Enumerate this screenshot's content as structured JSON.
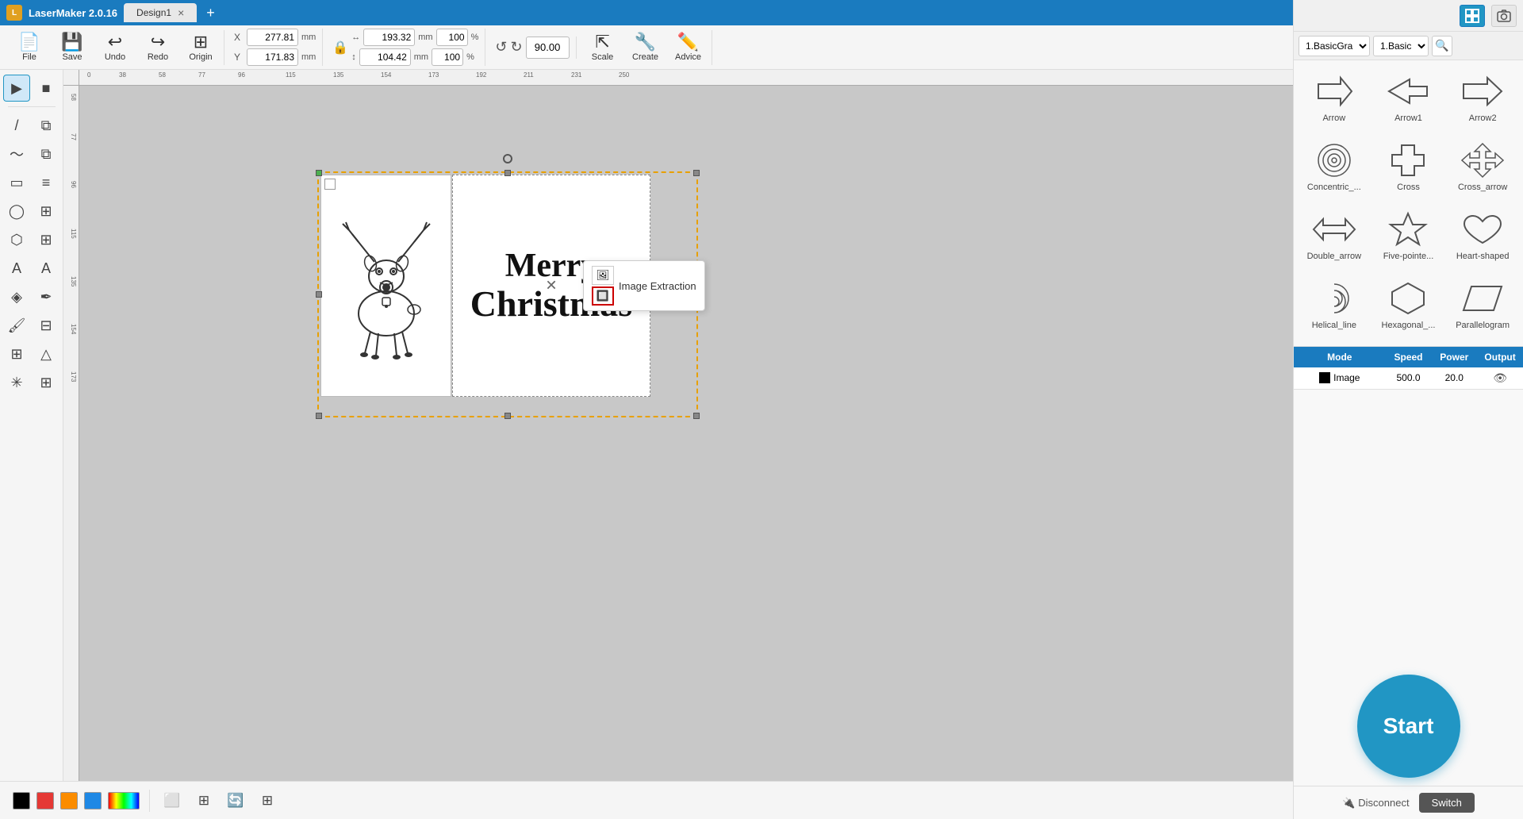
{
  "app": {
    "name": "LaserMaker 2.0.16",
    "version": "2.0.16",
    "tab": "Design1"
  },
  "titlebar": {
    "app_label": "LaserMaker 2.0.16",
    "tab_label": "Design1",
    "tab_close": "×",
    "tab_add": "+",
    "minimize": "—",
    "maximize": "❐",
    "close": "×"
  },
  "toolbar": {
    "file_label": "File",
    "save_label": "Save",
    "undo_label": "Undo",
    "redo_label": "Redo",
    "origin_label": "Origin",
    "scale_label": "Scale",
    "create_label": "Create",
    "advice_label": "Advice",
    "x_label": "X",
    "y_label": "Y",
    "x_value": "277.81",
    "y_value": "171.83",
    "mm_label": "mm",
    "w_value": "193.32",
    "h_value": "104.42",
    "w_pct": "100",
    "h_pct": "100",
    "pct_label": "%",
    "rotate_value": "90.00"
  },
  "shapes_panel": {
    "filter1": "1.BasicGra",
    "filter2": "1.Basic",
    "shapes": [
      {
        "id": "arrow",
        "label": "Arrow"
      },
      {
        "id": "arrow1",
        "label": "Arrow1"
      },
      {
        "id": "arrow2",
        "label": "Arrow2"
      },
      {
        "id": "concentric",
        "label": "Concentric_..."
      },
      {
        "id": "cross",
        "label": "Cross"
      },
      {
        "id": "cross_arrow",
        "label": "Cross_arrow"
      },
      {
        "id": "double_arrow",
        "label": "Double_arrow"
      },
      {
        "id": "five_pointer",
        "label": "Five-pointe..."
      },
      {
        "id": "heart_shaped",
        "label": "Heart-shaped"
      },
      {
        "id": "helical_line",
        "label": "Helical_line"
      },
      {
        "id": "hexagonal",
        "label": "Hexagonal_..."
      },
      {
        "id": "parallelogram",
        "label": "Parallelogram"
      }
    ]
  },
  "laser_settings": {
    "headers": [
      "Mode",
      "Speed",
      "Power",
      "Output"
    ],
    "rows": [
      {
        "mode": "Image",
        "color": "#000000",
        "speed": "500.0",
        "power": "20.0",
        "output": true
      }
    ]
  },
  "canvas": {
    "x_coord": "277.81",
    "y_coord": "171.83"
  },
  "image_extraction": {
    "label": "Image Extraction"
  },
  "start_button": {
    "label": "Start"
  },
  "bottom_actions": {
    "disconnect_label": "Disconnect",
    "switch_label": "Switch"
  },
  "colors": {
    "black": "#000000",
    "red": "#e53935",
    "orange": "#fb8c00",
    "blue": "#1e88e5",
    "gradient": "linear-gradient(to right, #f00, #ff0, #0f0, #0ff, #00f)"
  }
}
